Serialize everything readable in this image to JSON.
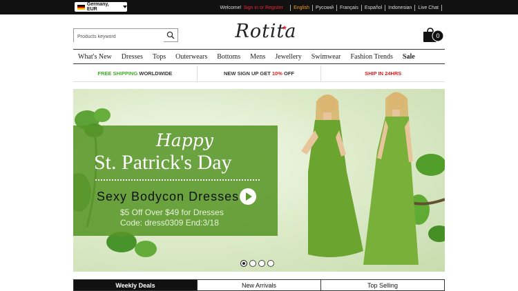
{
  "topbar": {
    "locale": "Germany, EUR",
    "welcome": "Welcome!",
    "signin": "Sign in or Register",
    "languages": [
      "English",
      "Русский",
      "Français",
      "Español",
      "Indonesian"
    ],
    "live_chat": "Live Chat"
  },
  "header": {
    "search_placeholder": "Products keyword",
    "logo": "Rotita",
    "cart_count": "0"
  },
  "nav": [
    "What's New",
    "Dresses",
    "Tops",
    "Outerwears",
    "Bottoms",
    "Mens",
    "Jewellery",
    "Swimwear",
    "Fashion Trends",
    "Sale"
  ],
  "promo": {
    "free_a": "FREE SHIPPING",
    "free_b": "WORLDWIDE",
    "signup_a": "NEW SIGN UP GET",
    "signup_b": "10%",
    "signup_c": "OFF",
    "ship": "SHIP IN 24HRS"
  },
  "banner": {
    "happy": "Happy",
    "headline": "St. Patrick's Day",
    "subheadline": "Sexy Bodycon Dresses",
    "offer_line1": "$5 Off Over $49 for Dresses",
    "offer_line2": "Code: dress0309   End:3/18",
    "slide_count": 4,
    "active_slide": 1
  },
  "tabs": [
    "Weekly Deals",
    "New Arrivals",
    "Top Selling"
  ],
  "colors": {
    "accent_green": "#3fae2a",
    "accent_red": "#e0201f",
    "lang_active": "#f39c12",
    "panel_green": "#589628"
  }
}
